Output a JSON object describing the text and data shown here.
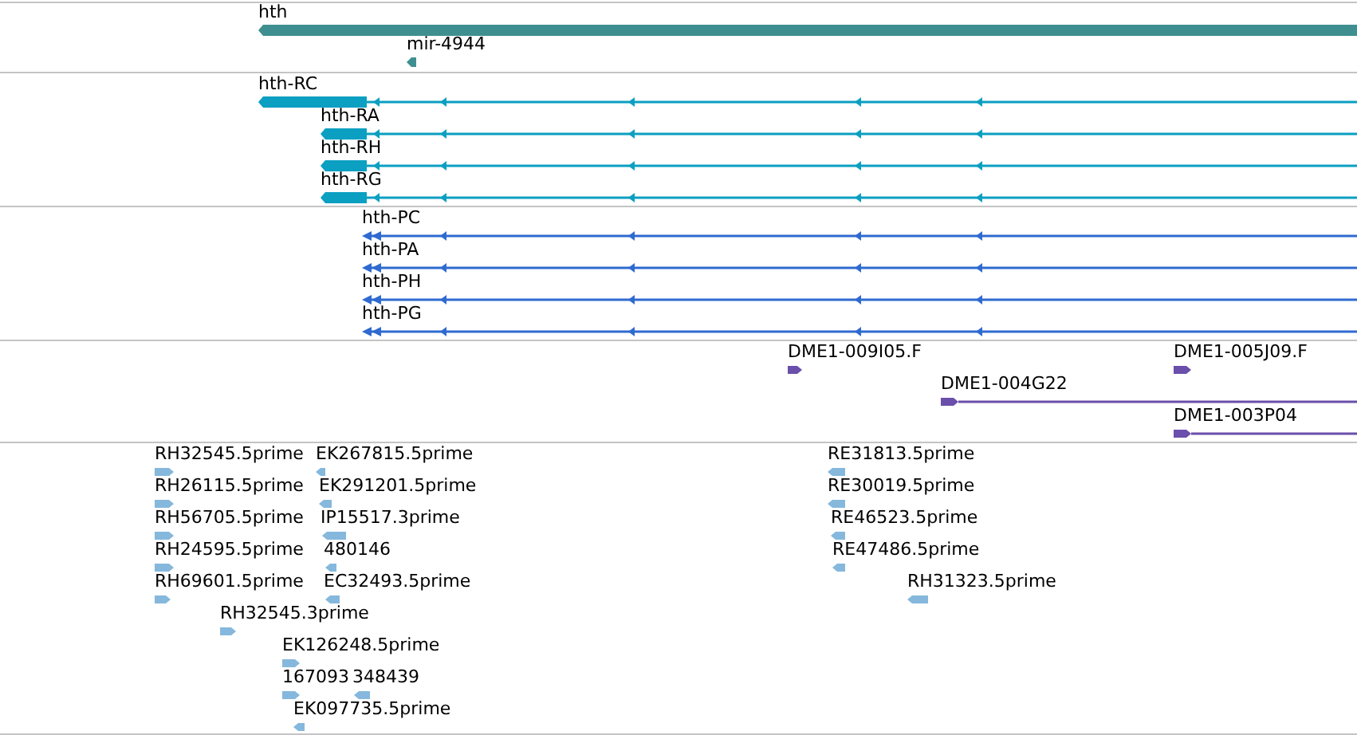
{
  "tracks": [
    {
      "kind": "gene",
      "features": [
        {
          "label": "hth",
          "reverse": true
        },
        {
          "label": "mir-4944",
          "reverse": true
        }
      ]
    },
    {
      "kind": "transcript",
      "features": [
        {
          "label": "hth-RC",
          "reverse": true
        },
        {
          "label": "hth-RA",
          "reverse": true
        },
        {
          "label": "hth-RH",
          "reverse": true
        },
        {
          "label": "hth-RG",
          "reverse": true
        }
      ]
    },
    {
      "kind": "protein",
      "features": [
        {
          "label": "hth-PC",
          "reverse": true
        },
        {
          "label": "hth-PA",
          "reverse": true
        },
        {
          "label": "hth-PH",
          "reverse": true
        },
        {
          "label": "hth-PG",
          "reverse": true
        }
      ]
    },
    {
      "kind": "clone",
      "features": [
        {
          "label": "DME1-009I05.F",
          "reverse": false
        },
        {
          "label": "DME1-005J09.F",
          "reverse": false
        },
        {
          "label": "DME1-004G22",
          "reverse": false
        },
        {
          "label": "DME1-003P04",
          "reverse": false
        }
      ]
    },
    {
      "kind": "est",
      "features": [
        {
          "label": "RH32545.5prime",
          "reverse": false
        },
        {
          "label": "EK267815.5prime",
          "reverse": true
        },
        {
          "label": "RH26115.5prime",
          "reverse": false
        },
        {
          "label": "EK291201.5prime",
          "reverse": true
        },
        {
          "label": "RH56705.5prime",
          "reverse": false
        },
        {
          "label": "IP15517.3prime",
          "reverse": true
        },
        {
          "label": "RH24595.5prime",
          "reverse": false
        },
        {
          "label": "480146",
          "reverse": true
        },
        {
          "label": "RH69601.5prime",
          "reverse": false
        },
        {
          "label": "EC32493.5prime",
          "reverse": true
        },
        {
          "label": "RH32545.3prime",
          "reverse": false
        },
        {
          "label": "EK126248.5prime",
          "reverse": false
        },
        {
          "label": "167093",
          "reverse": false
        },
        {
          "label": "348439",
          "reverse": true
        },
        {
          "label": "EK097735.5prime",
          "reverse": true
        },
        {
          "label": "RE31813.5prime",
          "reverse": true
        },
        {
          "label": "RE30019.5prime",
          "reverse": true
        },
        {
          "label": "RE46523.5prime",
          "reverse": true
        },
        {
          "label": "RE47486.5prime",
          "reverse": true
        },
        {
          "label": "RH31323.5prime",
          "reverse": true
        }
      ]
    }
  ]
}
